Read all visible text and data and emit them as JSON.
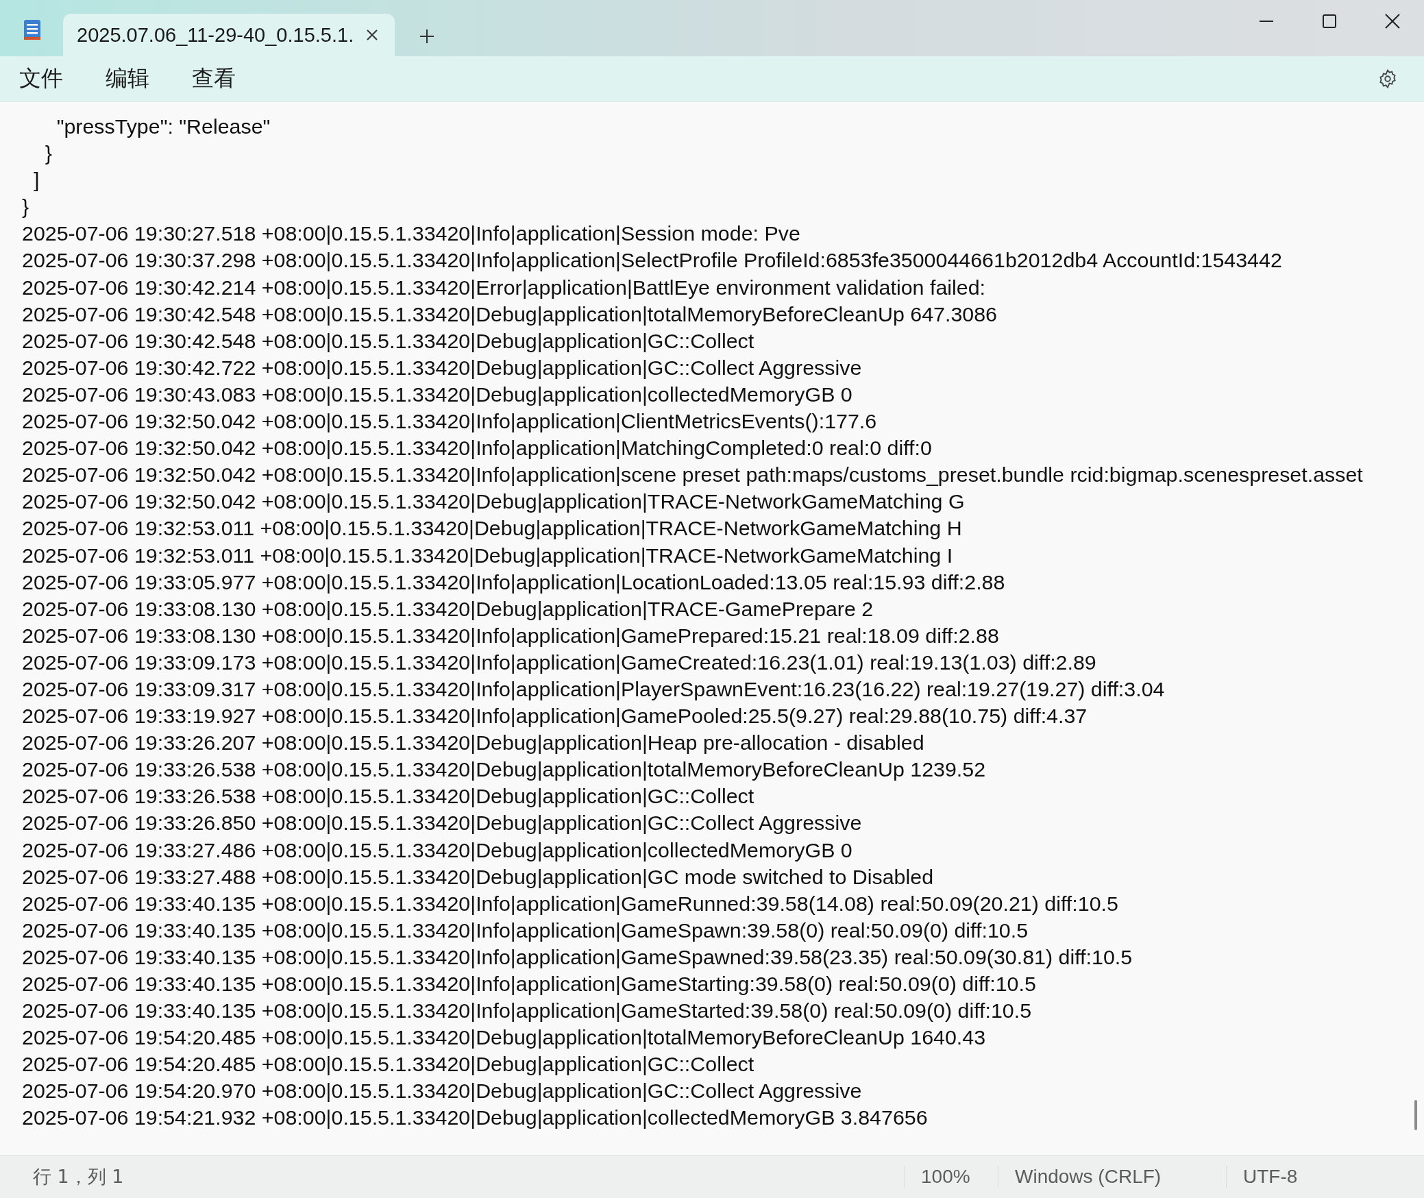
{
  "tab": {
    "title": "2025.07.06_11-29-40_0.15.5.1.",
    "selected": true
  },
  "menu": [
    "文件",
    "编辑",
    "查看"
  ],
  "lines": [
    "      \"pressType\": \"Release\"",
    "    }",
    "  ]",
    "}",
    "2025-07-06 19:30:27.518 +08:00|0.15.5.1.33420|Info|application|Session mode: Pve",
    "2025-07-06 19:30:37.298 +08:00|0.15.5.1.33420|Info|application|SelectProfile ProfileId:6853fe3500044661b2012db4 AccountId:1543442",
    "2025-07-06 19:30:42.214 +08:00|0.15.5.1.33420|Error|application|BattlEye environment validation failed:",
    "2025-07-06 19:30:42.548 +08:00|0.15.5.1.33420|Debug|application|totalMemoryBeforeCleanUp 647.3086",
    "2025-07-06 19:30:42.548 +08:00|0.15.5.1.33420|Debug|application|GC::Collect",
    "2025-07-06 19:30:42.722 +08:00|0.15.5.1.33420|Debug|application|GC::Collect Aggressive",
    "2025-07-06 19:30:43.083 +08:00|0.15.5.1.33420|Debug|application|collectedMemoryGB 0",
    "2025-07-06 19:32:50.042 +08:00|0.15.5.1.33420|Info|application|ClientMetricsEvents():177.6",
    "2025-07-06 19:32:50.042 +08:00|0.15.5.1.33420|Info|application|MatchingCompleted:0 real:0 diff:0",
    "2025-07-06 19:32:50.042 +08:00|0.15.5.1.33420|Info|application|scene preset path:maps/customs_preset.bundle rcid:bigmap.scenespreset.asset",
    "2025-07-06 19:32:50.042 +08:00|0.15.5.1.33420|Debug|application|TRACE-NetworkGameMatching G",
    "2025-07-06 19:32:53.011 +08:00|0.15.5.1.33420|Debug|application|TRACE-NetworkGameMatching H",
    "2025-07-06 19:32:53.011 +08:00|0.15.5.1.33420|Debug|application|TRACE-NetworkGameMatching I",
    "2025-07-06 19:33:05.977 +08:00|0.15.5.1.33420|Info|application|LocationLoaded:13.05 real:15.93 diff:2.88",
    "2025-07-06 19:33:08.130 +08:00|0.15.5.1.33420|Debug|application|TRACE-GamePrepare 2",
    "2025-07-06 19:33:08.130 +08:00|0.15.5.1.33420|Info|application|GamePrepared:15.21 real:18.09 diff:2.88",
    "2025-07-06 19:33:09.173 +08:00|0.15.5.1.33420|Info|application|GameCreated:16.23(1.01) real:19.13(1.03) diff:2.89",
    "2025-07-06 19:33:09.317 +08:00|0.15.5.1.33420|Info|application|PlayerSpawnEvent:16.23(16.22) real:19.27(19.27) diff:3.04",
    "2025-07-06 19:33:19.927 +08:00|0.15.5.1.33420|Info|application|GamePooled:25.5(9.27) real:29.88(10.75) diff:4.37",
    "2025-07-06 19:33:26.207 +08:00|0.15.5.1.33420|Debug|application|Heap pre-allocation - disabled",
    "2025-07-06 19:33:26.538 +08:00|0.15.5.1.33420|Debug|application|totalMemoryBeforeCleanUp 1239.52",
    "2025-07-06 19:33:26.538 +08:00|0.15.5.1.33420|Debug|application|GC::Collect",
    "2025-07-06 19:33:26.850 +08:00|0.15.5.1.33420|Debug|application|GC::Collect Aggressive",
    "2025-07-06 19:33:27.486 +08:00|0.15.5.1.33420|Debug|application|collectedMemoryGB 0",
    "2025-07-06 19:33:27.488 +08:00|0.15.5.1.33420|Debug|application|GC mode switched to Disabled",
    "2025-07-06 19:33:40.135 +08:00|0.15.5.1.33420|Info|application|GameRunned:39.58(14.08) real:50.09(20.21) diff:10.5",
    "2025-07-06 19:33:40.135 +08:00|0.15.5.1.33420|Info|application|GameSpawn:39.58(0) real:50.09(0) diff:10.5",
    "2025-07-06 19:33:40.135 +08:00|0.15.5.1.33420|Info|application|GameSpawned:39.58(23.35) real:50.09(30.81) diff:10.5",
    "2025-07-06 19:33:40.135 +08:00|0.15.5.1.33420|Info|application|GameStarting:39.58(0) real:50.09(0) diff:10.5",
    "2025-07-06 19:33:40.135 +08:00|0.15.5.1.33420|Info|application|GameStarted:39.58(0) real:50.09(0) diff:10.5",
    "2025-07-06 19:54:20.485 +08:00|0.15.5.1.33420|Debug|application|totalMemoryBeforeCleanUp 1640.43",
    "2025-07-06 19:54:20.485 +08:00|0.15.5.1.33420|Debug|application|GC::Collect",
    "2025-07-06 19:54:20.970 +08:00|0.15.5.1.33420|Debug|application|GC::Collect Aggressive",
    "2025-07-06 19:54:21.932 +08:00|0.15.5.1.33420|Debug|application|collectedMemoryGB 3.847656"
  ],
  "status_bar": {
    "position": "行 1，列 1",
    "zoom": "100%",
    "line_ending": "Windows (CRLF)",
    "encoding": "UTF-8"
  }
}
